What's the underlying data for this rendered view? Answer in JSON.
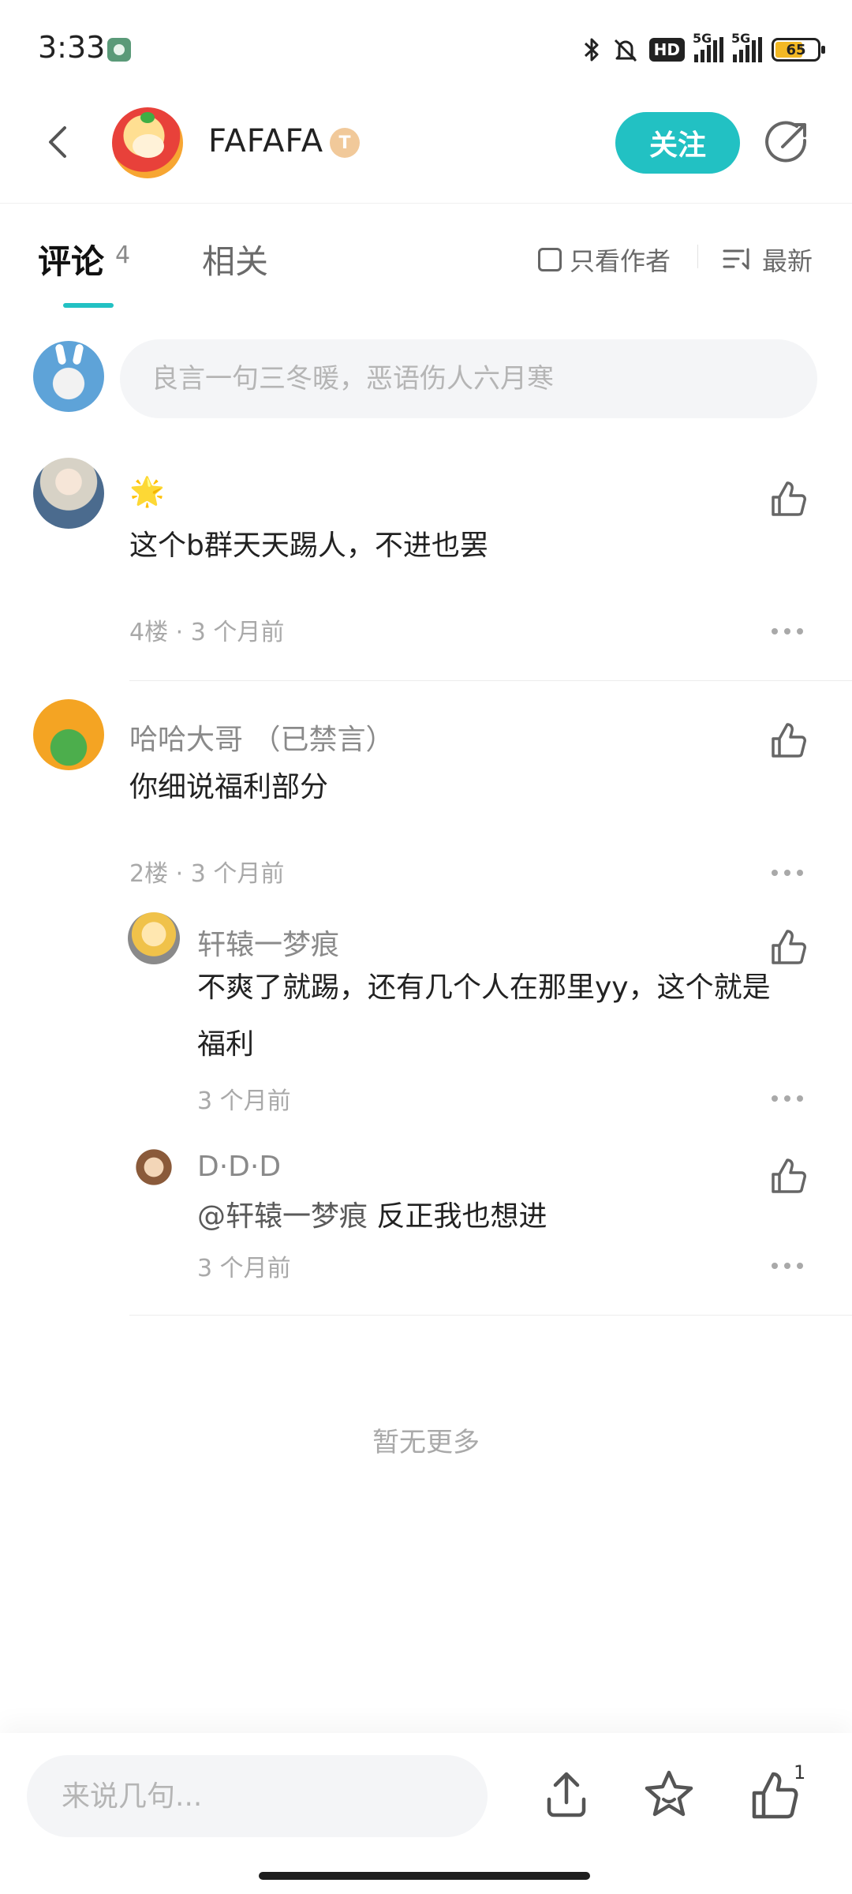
{
  "status_bar": {
    "time": "3:33",
    "hd_label": "HD",
    "signal1_label": "5G",
    "signal2_label": "5G",
    "battery_level": "65"
  },
  "header": {
    "author_name": "FAFAFA",
    "level_badge": "T",
    "follow_label": "关注"
  },
  "tabs": {
    "comments_label": "评论",
    "comments_count": "4",
    "related_label": "相关",
    "author_only_label": "只看作者",
    "sort_label": "最新"
  },
  "composer": {
    "placeholder": "良言一句三冬暖，恶语伤人六月寒"
  },
  "comments": [
    {
      "name": "🌟",
      "text": "这个b群天天踢人，不进也罢",
      "meta": "4楼 · 3 个月前"
    },
    {
      "name": "哈哈大哥 （已禁言）",
      "text": "你细说福利部分",
      "meta": "2楼 · 3 个月前",
      "replies": [
        {
          "name": "轩辕一梦痕",
          "text": "不爽了就踢，还有几个人在那里yy，这个就是福利",
          "meta": "3 个月前"
        },
        {
          "name": "D·D·D",
          "mention": "@轩辕一梦痕",
          "text": "反正我也想进",
          "meta": "3 个月前"
        }
      ]
    }
  ],
  "no_more_text": "暂无更多",
  "bottom_bar": {
    "placeholder": "来说几句...",
    "like_count": "1"
  },
  "colors": {
    "accent": "#22c1c3",
    "text_primary": "#222222",
    "text_secondary": "#8a8a8a",
    "text_muted": "#a9a9a9",
    "input_bg": "#f4f5f7"
  }
}
